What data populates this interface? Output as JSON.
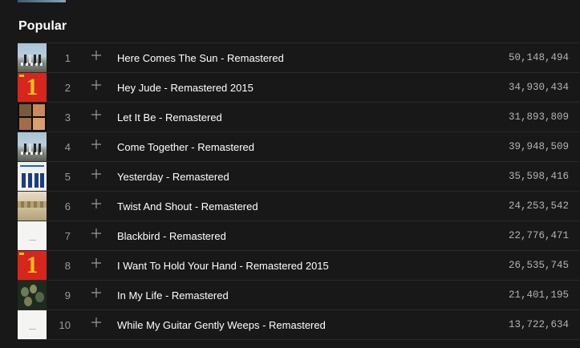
{
  "section": {
    "title": "Popular"
  },
  "icons": {
    "add": "plus-icon"
  },
  "colors": {
    "background": "#181818",
    "divider": "#2a2a2a",
    "text_primary": "#ffffff",
    "text_secondary": "#9b9b9b"
  },
  "tracks": [
    {
      "num": "1",
      "title": "Here Comes The Sun - Remastered",
      "plays": "50,148,494",
      "album_art": "abbey-road"
    },
    {
      "num": "2",
      "title": "Hey Jude - Remastered 2015",
      "plays": "34,930,434",
      "album_art": "one-red"
    },
    {
      "num": "3",
      "title": "Let It Be - Remastered",
      "plays": "31,893,809",
      "album_art": "let-it-be"
    },
    {
      "num": "4",
      "title": "Come Together - Remastered",
      "plays": "39,948,509",
      "album_art": "abbey-road"
    },
    {
      "num": "5",
      "title": "Yesterday - Remastered",
      "plays": "35,598,416",
      "album_art": "help"
    },
    {
      "num": "6",
      "title": "Twist And Shout - Remastered",
      "plays": "24,253,542",
      "album_art": "sgt-pepper"
    },
    {
      "num": "7",
      "title": "Blackbird - Remastered",
      "plays": "22,776,471",
      "album_art": "white-album"
    },
    {
      "num": "8",
      "title": "I Want To Hold Your Hand - Remastered 2015",
      "plays": "26,535,745",
      "album_art": "one-red"
    },
    {
      "num": "9",
      "title": "In My Life - Remastered",
      "plays": "21,401,195",
      "album_art": "rubber-soul"
    },
    {
      "num": "10",
      "title": "While My Guitar Gently Weeps - Remastered",
      "plays": "13,722,634",
      "album_art": "white-album"
    }
  ]
}
